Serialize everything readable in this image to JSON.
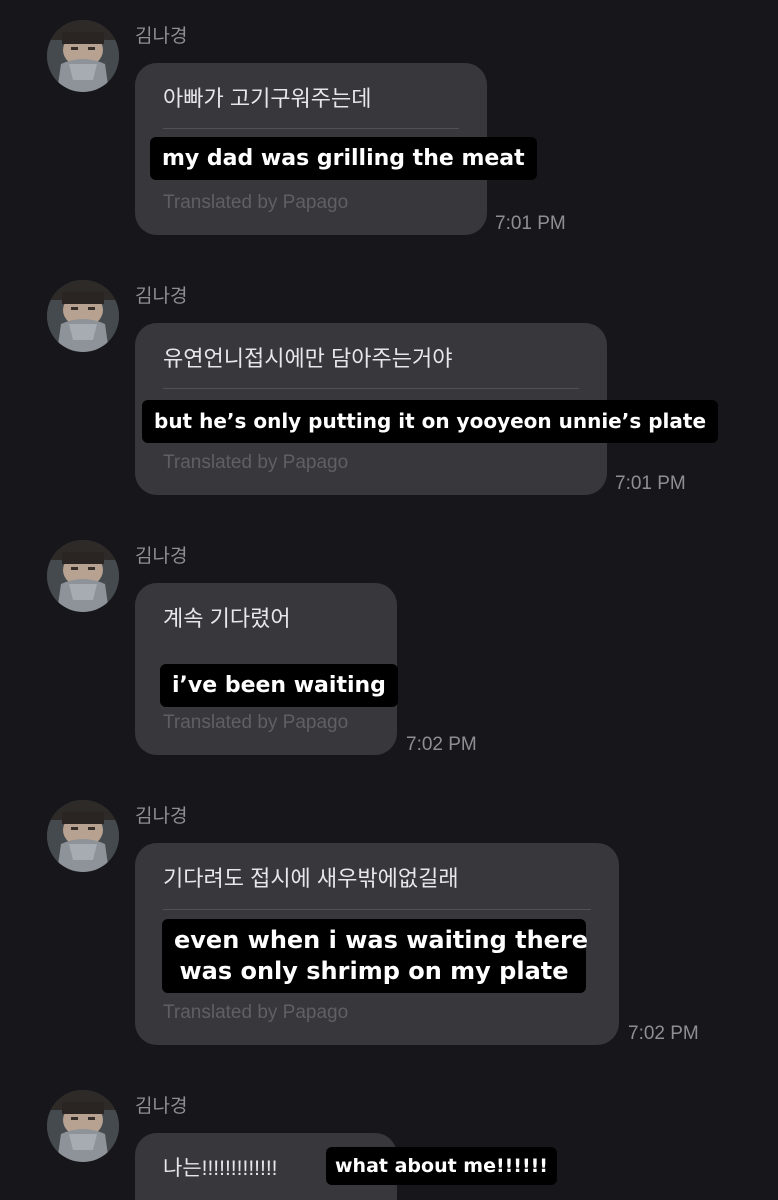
{
  "messages": [
    {
      "sender": "김나경",
      "original": "아빠가 고기구워주는데",
      "translation": "my dad was grilling the meat",
      "credit": "Translated by Papago",
      "time": "7:01 PM"
    },
    {
      "sender": "김나경",
      "original": "유연언니접시에만 담아주는거야",
      "translation": "but he’s only putting it on yooyeon unnie’s plate",
      "credit": "Translated by Papago",
      "time": "7:01 PM"
    },
    {
      "sender": "김나경",
      "original": "계속 기다렸어",
      "translation": "i’ve been waiting",
      "credit": "Translated by Papago",
      "time": "7:02 PM"
    },
    {
      "sender": "김나경",
      "original": "기다려도 접시에 새우밖에없길래",
      "translation_lines": [
        "even when i was waiting there",
        "was only shrimp on my plate"
      ],
      "credit": "Translated by Papago",
      "time": "7:02 PM"
    },
    {
      "sender": "김나경",
      "original": "나는!!!!!!!!!!!!!",
      "translation": "what about me!!!!!!"
    }
  ],
  "colors": {
    "background": "#17171b",
    "bubble": "#37373c",
    "caption_background": "#000000"
  },
  "icons": {
    "avatar": "profile-photo"
  }
}
